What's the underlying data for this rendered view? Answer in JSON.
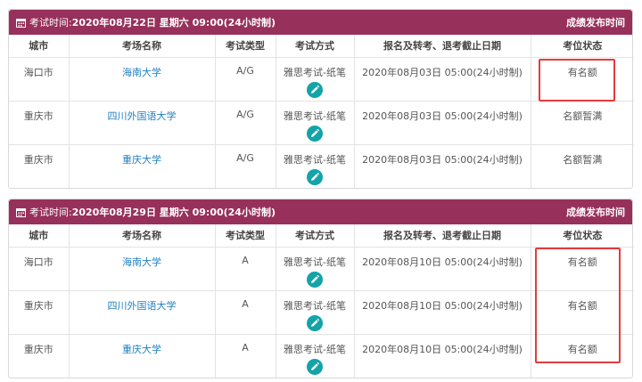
{
  "headers": [
    "城市",
    "考场名称",
    "考试类型",
    "考试方式",
    "报名及转考、退考截止日期",
    "考位状态"
  ],
  "blocks": [
    {
      "title_prefix": "考试时间: ",
      "title_date": "2020年08月22日 星期六 09:00(24小时制)",
      "result_label": "成绩发布时间",
      "rows": [
        {
          "city": "海口市",
          "venue": "海南大学",
          "type": "A/G",
          "mode": "雅思考试-纸笔",
          "deadline": "2020年08月03日 05:00(24小时制)",
          "status": "有名额"
        },
        {
          "city": "重庆市",
          "venue": "四川外国语大学",
          "type": "A/G",
          "mode": "雅思考试-纸笔",
          "deadline": "2020年08月03日 05:00(24小时制)",
          "status": "名额暂满"
        },
        {
          "city": "重庆市",
          "venue": "重庆大学",
          "type": "A/G",
          "mode": "雅思考试-纸笔",
          "deadline": "2020年08月03日 05:00(24小时制)",
          "status": "名额暂满"
        }
      ]
    },
    {
      "title_prefix": "考试时间: ",
      "title_date": "2020年08月29日 星期六 09:00(24小时制)",
      "result_label": "成绩发布时间",
      "rows": [
        {
          "city": "海口市",
          "venue": "海南大学",
          "type": "A",
          "mode": "雅思考试-纸笔",
          "deadline": "2020年08月10日 05:00(24小时制)",
          "status": "有名额"
        },
        {
          "city": "重庆市",
          "venue": "四川外国语大学",
          "type": "A",
          "mode": "雅思考试-纸笔",
          "deadline": "2020年08月10日 05:00(24小时制)",
          "status": "有名额"
        },
        {
          "city": "重庆市",
          "venue": "重庆大学",
          "type": "A",
          "mode": "雅思考试-纸笔",
          "deadline": "2020年08月10日 05:00(24小时制)",
          "status": "有名额"
        }
      ]
    }
  ],
  "icons": {
    "calendar": "calendar-icon",
    "edit": "pencil-icon"
  },
  "colors": {
    "header_bg": "#97305a",
    "link": "#1f7fbf",
    "edit_button": "#13a3a8",
    "highlight": "#e53b3b"
  }
}
